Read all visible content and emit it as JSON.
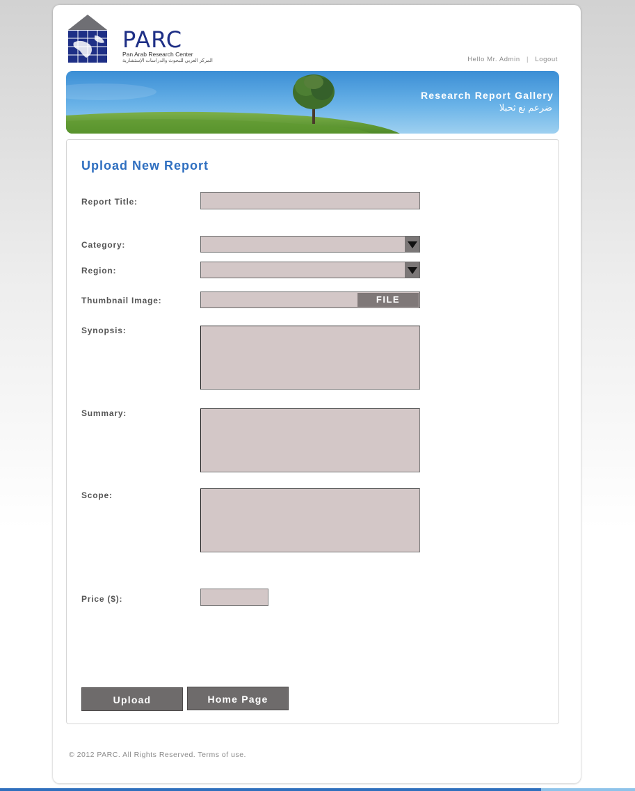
{
  "brand": {
    "name": "PARC",
    "subtitle": "Pan Arab Research Center",
    "subtitle_ar": "المركز العربي للبحوث والدراسات الإستشارية"
  },
  "user_bar": {
    "greeting": "Hello Mr. Admin",
    "separator": "|",
    "logout_label": "Logout"
  },
  "banner": {
    "title": "Research Report Gallery",
    "subtitle_ar": "ضرعم نع ثحبلا"
  },
  "form": {
    "title": "Upload New Report",
    "report_title": {
      "label": "Report Title:",
      "value": ""
    },
    "category": {
      "label": "Category:",
      "selected": ""
    },
    "region": {
      "label": "Region:",
      "selected": ""
    },
    "thumbnail": {
      "label": "Thumbnail Image:",
      "button_label": "FILE"
    },
    "synopsis": {
      "label": "Synopsis:",
      "value": ""
    },
    "summary": {
      "label": "Summary:",
      "value": ""
    },
    "scope": {
      "label": "Scope:",
      "value": ""
    },
    "price": {
      "label": "Price ($):",
      "value": ""
    },
    "upload_label": "Upload",
    "home_label": "Home Page"
  },
  "footer": {
    "copyright": "© 2012 PARC. All Rights Reserved. Terms of use."
  },
  "colors": {
    "accent": "#2f6fc0",
    "field_bg": "#d3c7c7",
    "button_bg": "#6e6b6b",
    "logo_blue": "#1e2f86"
  }
}
